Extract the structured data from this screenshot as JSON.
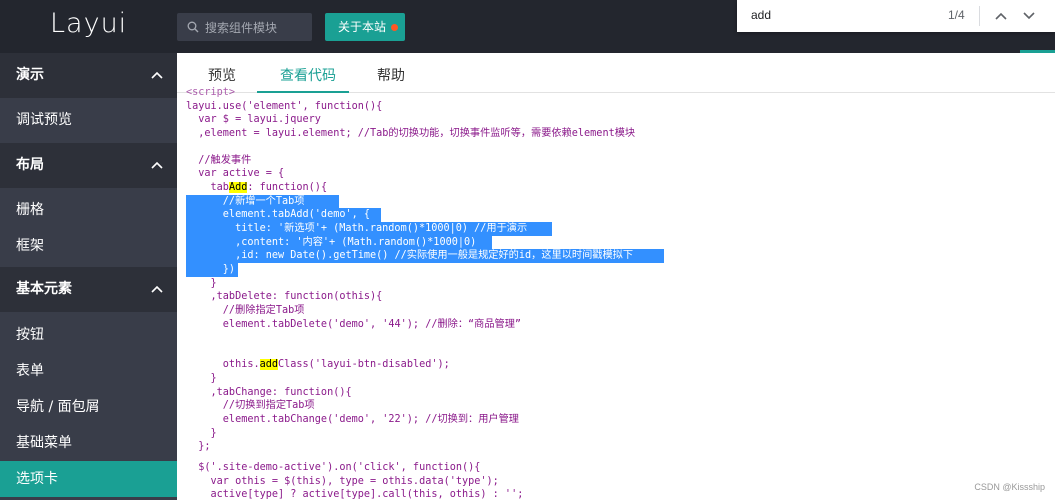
{
  "header": {
    "logo": "Layui",
    "search_placeholder": "搜索组件模块",
    "about_label": "关于本站"
  },
  "findbar": {
    "query": "add",
    "count": "1/4"
  },
  "sidebar": {
    "groups": [
      {
        "label": "演示"
      },
      {
        "label": "布局"
      },
      {
        "label": "基本元素"
      }
    ],
    "items": [
      {
        "label": "调试预览"
      },
      {
        "label": "栅格"
      },
      {
        "label": "框架"
      },
      {
        "label": "按钮"
      },
      {
        "label": "表单"
      },
      {
        "label": "导航 / 面包屑"
      },
      {
        "label": "基础菜单"
      },
      {
        "label": "选项卡"
      }
    ]
  },
  "tabs": [
    {
      "label": "预览"
    },
    {
      "label": "查看代码"
    },
    {
      "label": "帮助"
    }
  ],
  "code": {
    "l0": "<script>",
    "l1": "layui.use('element', function(){",
    "l2": "  var $ = layui.jquery",
    "l3": "  ,element = layui.element; //Tab的切换功能，切换事件监听等，需要依赖element模块",
    "l5": "  //触发事件",
    "l6": "  var active = {",
    "l7a": "    tab",
    "l7b": "Add",
    "l7c": ": function(){",
    "l8": "      //新增一个Tab项",
    "l9": "      element.tabAdd('demo', {",
    "l10": "        title: '新选项'+ (Math.random()*1000|0) //用于演示",
    "l11": "        ,content: '内容'+ (Math.random()*1000|0)",
    "l12": "        ,id: new Date().getTime() //实际使用一般是规定好的id，这里以时间戳模拟下",
    "l13": "      })",
    "l14": "    }",
    "l15": "    ,tabDelete: function(othis){",
    "l16": "      //删除指定Tab项",
    "l17": "      element.tabDelete('demo', '44'); //删除：“商品管理”",
    "l19a": "      othis.",
    "l19b": "add",
    "l19c": "Class('layui-btn-disabled');",
    "l20": "    }",
    "l21": "    ,tabChange: function(){",
    "l22": "      //切换到指定Tab项",
    "l23": "      element.tabChange('demo', '22'); //切换到：用户管理",
    "l24": "    }",
    "l25": "  };",
    "l27": "  $('.site-demo-active').on('click', function(){",
    "l28": "    var othis = $(this), type = othis.data('type');",
    "l29": "    active[type] ? active[type].call(this, othis) : '';",
    "l30": "  });"
  },
  "watermark": "CSDN @Kissship",
  "colors": {
    "header_bg": "#23262e",
    "sidebar_bg": "#393d49",
    "accent": "#1aa094",
    "selection": "#3390ff",
    "highlight": "#ffff00"
  }
}
